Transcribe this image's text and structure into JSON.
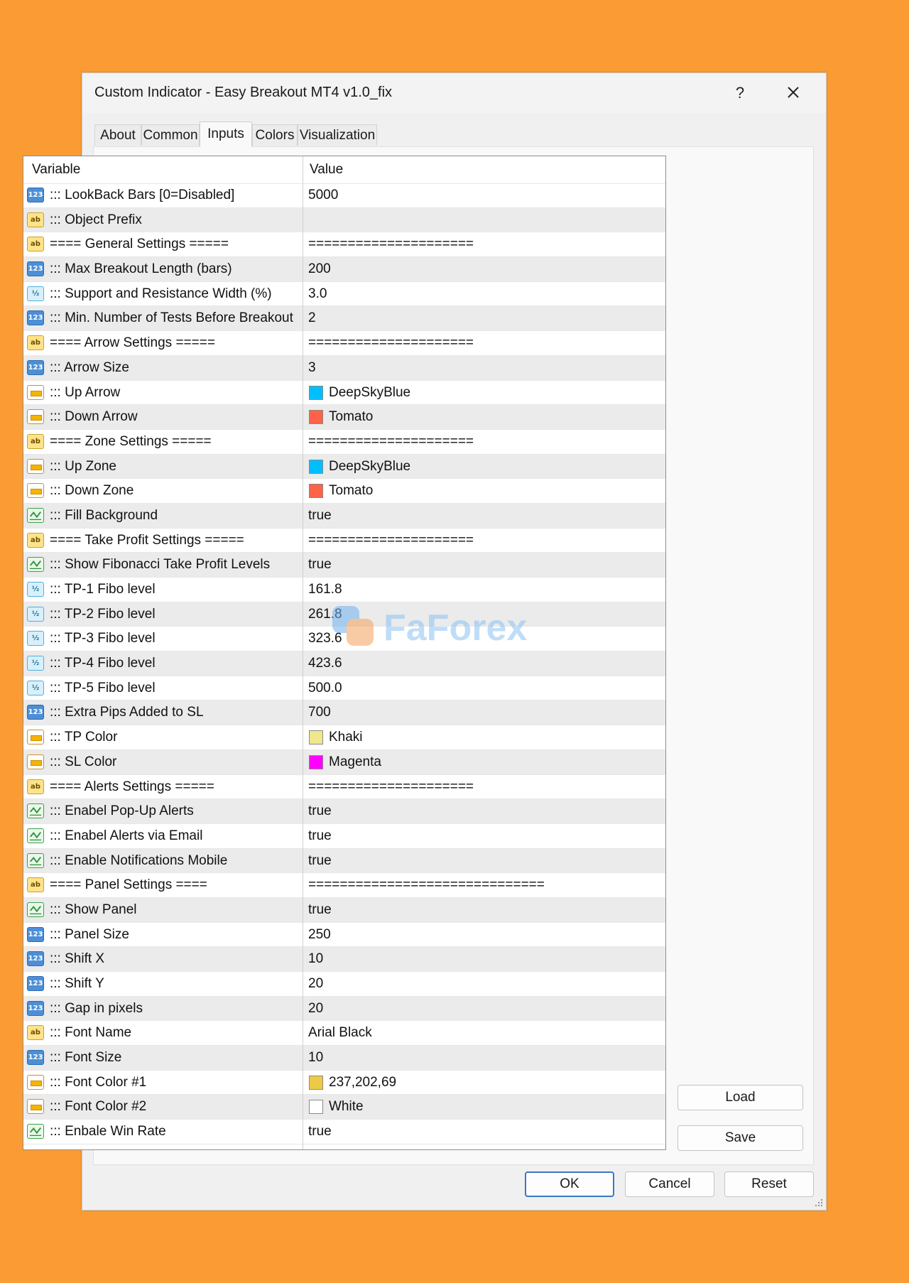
{
  "window": {
    "title": "Custom Indicator - Easy Breakout MT4 v1.0_fix",
    "help_label": "?"
  },
  "tabs": [
    {
      "label": "About"
    },
    {
      "label": "Common"
    },
    {
      "label": "Inputs"
    },
    {
      "label": "Colors"
    },
    {
      "label": "Visualization"
    }
  ],
  "active_tab": "Inputs",
  "grid": {
    "col_variable": "Variable",
    "col_value": "Value",
    "rows": [
      {
        "type": "int",
        "name": "::: LookBack Bars [0=Disabled]",
        "value": "5000"
      },
      {
        "type": "str",
        "name": "::: Object Prefix",
        "value": ""
      },
      {
        "type": "str",
        "name": "==== General Settings =====",
        "value": "====================="
      },
      {
        "type": "int",
        "name": "::: Max Breakout Length (bars)",
        "value": "200"
      },
      {
        "type": "dbl",
        "name": "::: Support and Resistance Width (%)",
        "value": "3.0"
      },
      {
        "type": "int",
        "name": "::: Min. Number of Tests Before Breakout",
        "value": "2"
      },
      {
        "type": "str",
        "name": "==== Arrow Settings =====",
        "value": "====================="
      },
      {
        "type": "int",
        "name": "::: Arrow Size",
        "value": "3"
      },
      {
        "type": "clr",
        "name": "::: Up Arrow",
        "value": "DeepSkyBlue",
        "color": "#00bfff"
      },
      {
        "type": "clr",
        "name": "::: Down Arrow",
        "value": "Tomato",
        "color": "#ff6347"
      },
      {
        "type": "str",
        "name": "==== Zone Settings =====",
        "value": "====================="
      },
      {
        "type": "clr",
        "name": "::: Up Zone",
        "value": "DeepSkyBlue",
        "color": "#00bfff"
      },
      {
        "type": "clr",
        "name": "::: Down Zone",
        "value": "Tomato",
        "color": "#ff6347"
      },
      {
        "type": "bool",
        "name": "::: Fill Background",
        "value": "true"
      },
      {
        "type": "str",
        "name": "==== Take Profit Settings =====",
        "value": "====================="
      },
      {
        "type": "bool",
        "name": "::: Show Fibonacci Take Profit Levels",
        "value": "true"
      },
      {
        "type": "dbl",
        "name": "::: TP-1 Fibo level",
        "value": "161.8"
      },
      {
        "type": "dbl",
        "name": "::: TP-2 Fibo level",
        "value": "261.8"
      },
      {
        "type": "dbl",
        "name": "::: TP-3 Fibo level",
        "value": "323.6"
      },
      {
        "type": "dbl",
        "name": "::: TP-4 Fibo level",
        "value": "423.6"
      },
      {
        "type": "dbl",
        "name": "::: TP-5 Fibo level",
        "value": "500.0"
      },
      {
        "type": "int",
        "name": "::: Extra Pips Added to SL",
        "value": "700"
      },
      {
        "type": "clr",
        "name": "::: TP Color",
        "value": "Khaki",
        "color": "#f0e68c"
      },
      {
        "type": "clr",
        "name": "::: SL Color",
        "value": "Magenta",
        "color": "#ff00ff"
      },
      {
        "type": "str",
        "name": "==== Alerts Settings =====",
        "value": "====================="
      },
      {
        "type": "bool",
        "name": "::: Enabel Pop-Up Alerts",
        "value": "true"
      },
      {
        "type": "bool",
        "name": "::: Enabel Alerts via Email",
        "value": "true"
      },
      {
        "type": "bool",
        "name": "::: Enable Notifications Mobile",
        "value": "true"
      },
      {
        "type": "str",
        "name": "==== Panel Settings ====",
        "value": "=============================="
      },
      {
        "type": "bool",
        "name": "::: Show Panel",
        "value": "true"
      },
      {
        "type": "int",
        "name": "::: Panel Size",
        "value": "250"
      },
      {
        "type": "int",
        "name": "::: Shift X",
        "value": "10"
      },
      {
        "type": "int",
        "name": "::: Shift Y",
        "value": "20"
      },
      {
        "type": "int",
        "name": "::: Gap in pixels",
        "value": "20"
      },
      {
        "type": "str",
        "name": "::: Font Name",
        "value": "Arial Black"
      },
      {
        "type": "int",
        "name": "::: Font Size",
        "value": "10"
      },
      {
        "type": "clr",
        "name": "::: Font Color #1",
        "value": "237,202,69",
        "color": "#edca45"
      },
      {
        "type": "clr",
        "name": "::: Font Color #2",
        "value": "White",
        "color": "#ffffff"
      },
      {
        "type": "bool",
        "name": "::: Enbale Win Rate",
        "value": "true"
      }
    ]
  },
  "icons": {
    "int": "integer-type-icon",
    "str": "string-type-icon",
    "dbl": "double-type-icon",
    "clr": "color-type-icon",
    "bool": "boolean-type-icon"
  },
  "icon_text": {
    "int": "123",
    "str": "ab",
    "dbl": "½"
  },
  "buttons": {
    "load": "Load",
    "save": "Save",
    "ok": "OK",
    "cancel": "Cancel",
    "reset": "Reset"
  },
  "watermark": {
    "text": "FaForex"
  },
  "colors": {
    "background": "#fb9b33",
    "ok_border": "#3a78c9"
  }
}
